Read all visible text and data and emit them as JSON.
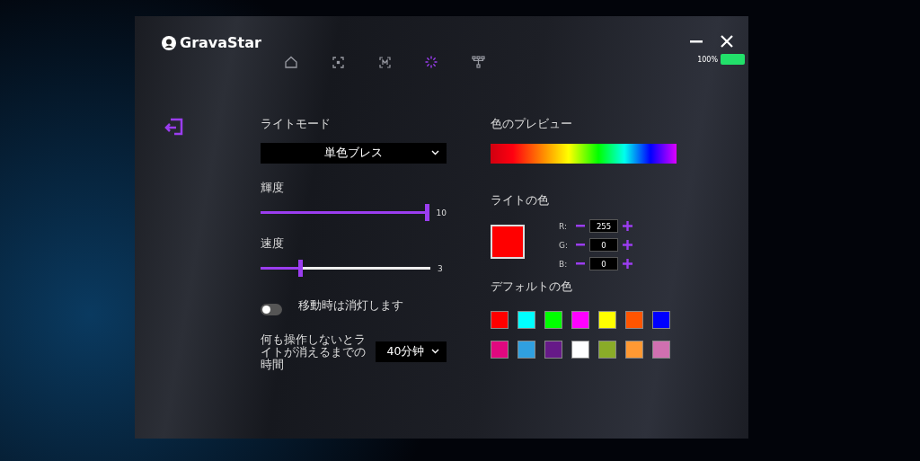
{
  "window": {
    "title": "GravaStar",
    "battery": {
      "reading": "100%",
      "level": 1
    }
  },
  "nav": [
    {
      "kind": "home",
      "selected": false
    },
    {
      "kind": "frame",
      "selected": false
    },
    {
      "kind": "macro",
      "selected": false
    },
    {
      "kind": "light",
      "selected": true
    },
    {
      "kind": "tree",
      "selected": false
    }
  ],
  "light_mode": {
    "label": "ライトモード",
    "value": "単色ブレス"
  },
  "sliders": [
    {
      "label": "輝度",
      "level": 1,
      "reading": "10"
    },
    {
      "label": "速度",
      "level": 0.23,
      "reading": "3"
    }
  ],
  "off_when_moving": {
    "label": "移動時は消灯します",
    "on": false
  },
  "idle_timeout": {
    "label": "何も操作しないとライトが消えるまでの時間",
    "value": "40分钟"
  },
  "preview": {
    "label": "色のプレビュー"
  },
  "light_color": {
    "label": "ライトの色",
    "color": "#ff0000",
    "channels": [
      {
        "name": "R:",
        "value": "255"
      },
      {
        "name": "G:",
        "value": "0"
      },
      {
        "name": "B:",
        "value": "0"
      }
    ]
  },
  "default_colors": {
    "label": "デフォルトの色",
    "swatches": [
      {
        "color": "#ff0000"
      },
      {
        "color": "#00ffff"
      },
      {
        "color": "#00ff00"
      },
      {
        "color": "#ff00ff"
      },
      {
        "color": "#ffff00"
      },
      {
        "color": "#ff5500"
      },
      {
        "color": "#0000ff"
      },
      {
        "color": "#e0087f"
      },
      {
        "color": "#30a0e0"
      },
      {
        "color": "#661a88"
      },
      {
        "color": "#ffffff"
      },
      {
        "color": "#8aac28"
      },
      {
        "color": "#ff9933"
      },
      {
        "color": "#d070b0"
      }
    ]
  }
}
